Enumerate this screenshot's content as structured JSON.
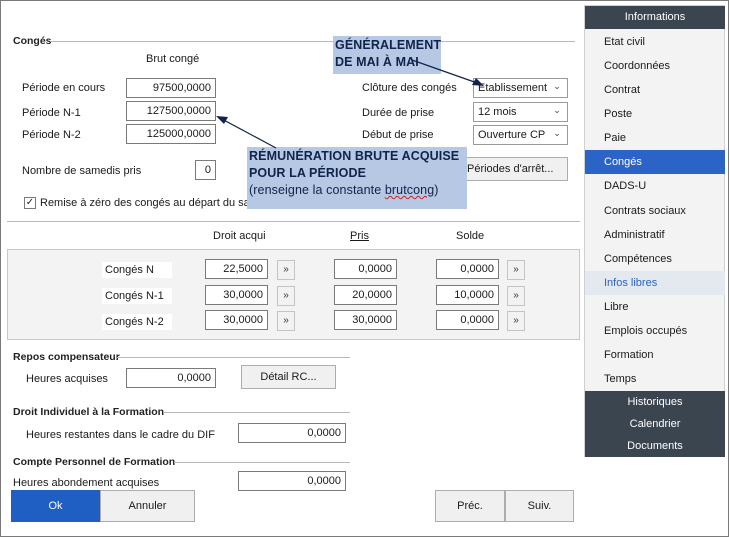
{
  "conges": {
    "group_title": "Congés",
    "brut_header": "Brut congé",
    "periode_en_cours_label": "Période en cours",
    "periode_en_cours_value": "97500,0000",
    "periode_n1_label": "Période N-1",
    "periode_n1_value": "127500,0000",
    "periode_n2_label": "Période N-2",
    "periode_n2_value": "125000,0000",
    "cloture_label": "Clôture des congés",
    "cloture_value": "Etablissement",
    "duree_label": "Durée de prise",
    "duree_value": "12 mois",
    "debut_label": "Début de prise",
    "debut_value": "Ouverture CP",
    "samedis_label": "Nombre de samedis pris",
    "samedis_value": "0",
    "periodes_arret_button": "Périodes d'arrêt...",
    "remise_checkbox_label": "Remise à zéro des congés au départ du sala",
    "remise_checked": true
  },
  "callouts": {
    "generalement_line1": "GÉNÉRALEMENT",
    "generalement_line2": "DE MAI À MAI",
    "remuneration_line1": "RÉMUNÉRATION BRUTE ACQUISE",
    "remuneration_line2": "POUR LA PÉRIODE",
    "remuneration_line3_prefix": "(renseigne la constante ",
    "remuneration_line3_word": "brutcong",
    "remuneration_line3_suffix": ")"
  },
  "grid": {
    "col_droit": "Droit acqui",
    "col_pris": "Pris",
    "col_solde": "Solde",
    "arrow_glyph": "»",
    "rows": [
      {
        "label": "Congés N",
        "droit": "22,5000",
        "pris": "0,0000",
        "solde": "0,0000"
      },
      {
        "label": "Congés N-1",
        "droit": "30,0000",
        "pris": "20,0000",
        "solde": "10,0000"
      },
      {
        "label": "Congés N-2",
        "droit": "30,0000",
        "pris": "30,0000",
        "solde": "0,0000"
      }
    ]
  },
  "repos": {
    "group_title": "Repos compensateur",
    "heures_label": "Heures acquises",
    "heures_value": "0,0000",
    "detail_button": "Détail RC..."
  },
  "dif": {
    "group_title": "Droit Individuel à la Formation",
    "heures_label": "Heures restantes dans le cadre du DIF",
    "heures_value": "0,0000"
  },
  "cpf": {
    "group_title": "Compte Personnel de Formation",
    "heures_label": "Heures abondement acquises",
    "heures_value": "0,0000"
  },
  "footer": {
    "ok": "Ok",
    "annuler": "Annuler",
    "prec": "Préc.",
    "suiv": "Suiv."
  },
  "sidebar": {
    "header": "Informations",
    "items": [
      {
        "label": "Etat civil"
      },
      {
        "label": "Coordonnées"
      },
      {
        "label": "Contrat"
      },
      {
        "label": "Poste"
      },
      {
        "label": "Paie"
      },
      {
        "label": "Congés"
      },
      {
        "label": "DADS-U"
      },
      {
        "label": "Contrats sociaux"
      },
      {
        "label": "Administratif"
      },
      {
        "label": "Compétences"
      },
      {
        "label": "Infos libres"
      },
      {
        "label": "Libre"
      },
      {
        "label": "Emplois occupés"
      },
      {
        "label": "Formation"
      },
      {
        "label": "Temps"
      }
    ],
    "sub_items": [
      {
        "label": "Historiques"
      },
      {
        "label": "Calendrier"
      },
      {
        "label": "Documents"
      }
    ]
  },
  "colors": {
    "active_blue": "#2b63c6",
    "dark_header": "#3a4550",
    "callout_bg": "#b6c8e4",
    "ok_blue": "#1f5fc4"
  }
}
